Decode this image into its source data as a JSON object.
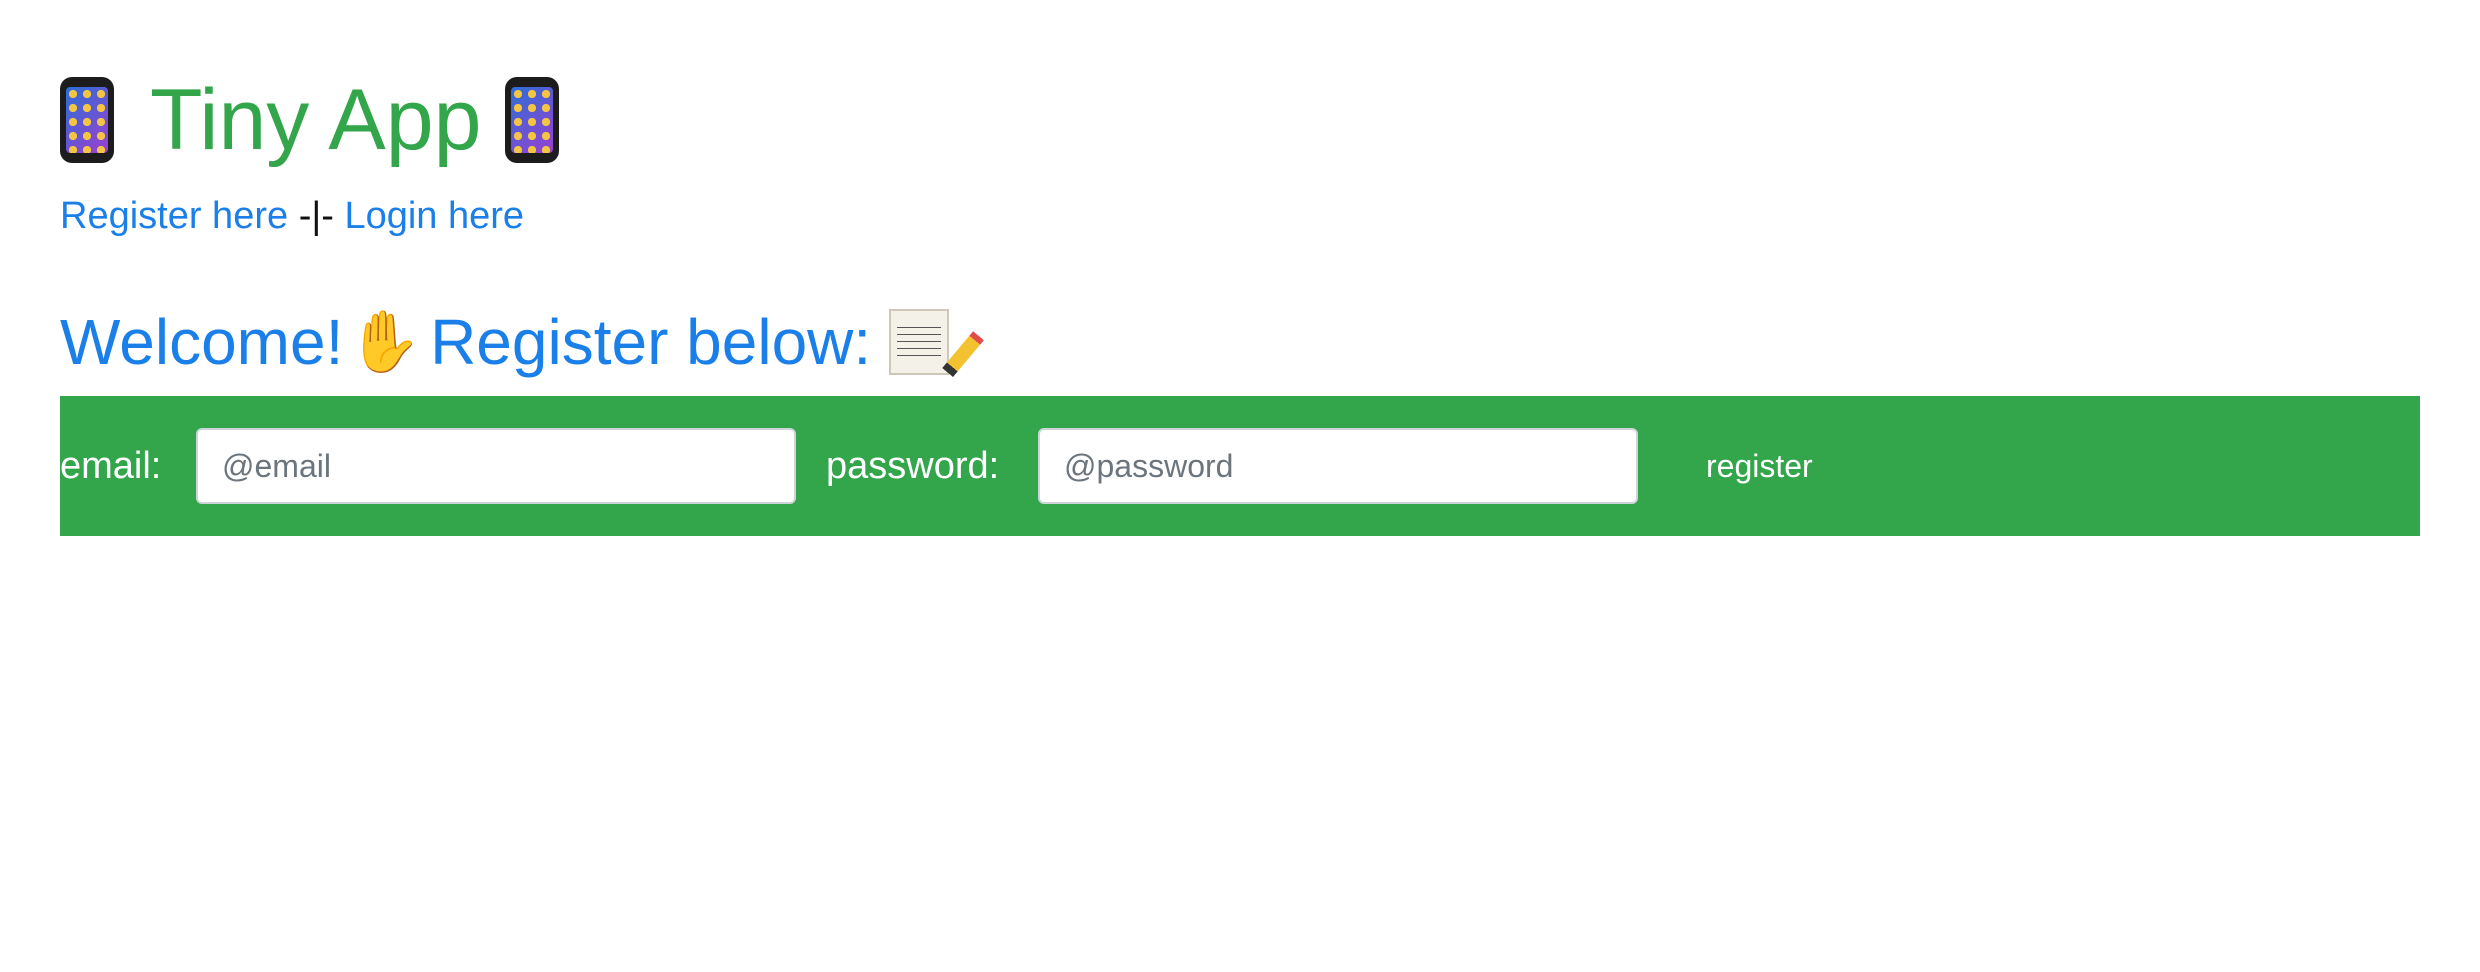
{
  "header": {
    "title": "Tiny App",
    "title_icon": "mobile-phone-icon",
    "title_color": "#33a54a"
  },
  "nav": {
    "register_link": "Register here",
    "separator": "-|-",
    "login_link": "Login here",
    "link_color": "#1a7fe8"
  },
  "welcome": {
    "text_1": "Welcome!",
    "wave_icon": "waving-hand-icon",
    "text_2": "Register below:",
    "memo_icon": "memo-pencil-icon",
    "color": "#1a7fe8"
  },
  "form": {
    "background_color": "#33a54a",
    "email_label": "email:",
    "email_placeholder": "@email",
    "email_value": "",
    "password_label": "password:",
    "password_placeholder": "@password",
    "password_value": "",
    "submit_label": "register"
  }
}
